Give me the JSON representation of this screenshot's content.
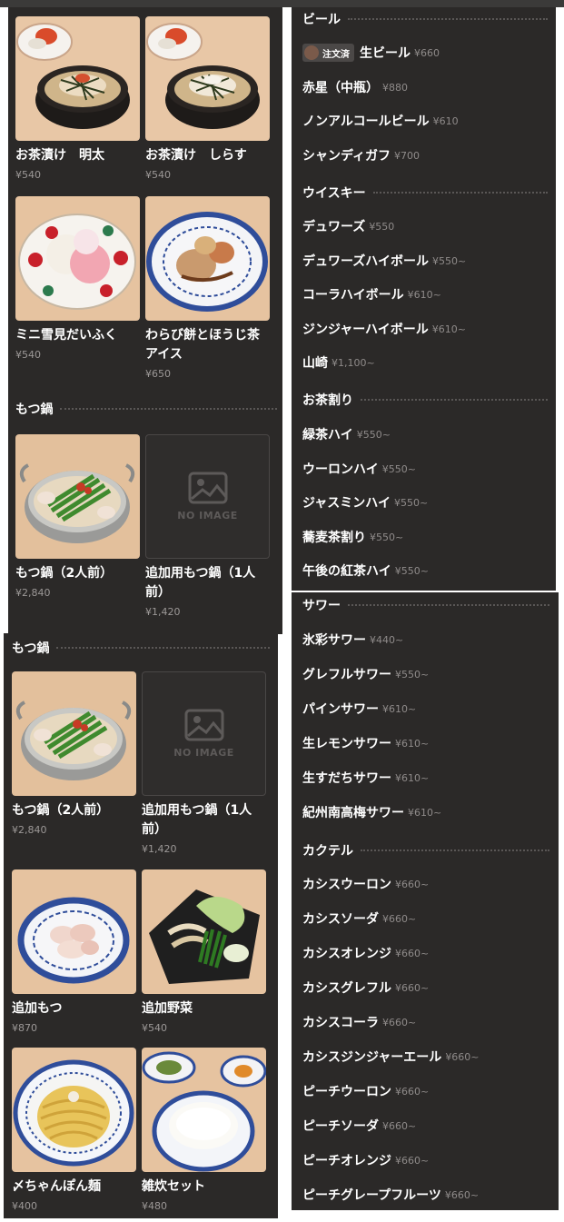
{
  "no_image_label": "NO IMAGE",
  "food_top": {
    "items": [
      {
        "name": "お茶漬け　明太",
        "price": "¥540"
      },
      {
        "name": "お茶漬け　しらす",
        "price": "¥540"
      },
      {
        "name": "ミニ雪見だいふく",
        "price": "¥540"
      },
      {
        "name": "わらび餅とほうじ茶アイス",
        "price": "¥650"
      }
    ],
    "section_title": "もつ鍋",
    "section_items": [
      {
        "name": "もつ鍋（2人前）",
        "price": "¥2,840"
      },
      {
        "name": "追加用もつ鍋（1人前）",
        "price": "¥1,420"
      }
    ]
  },
  "food_bottom": {
    "section_title": "もつ鍋",
    "items": [
      {
        "name": "もつ鍋（2人前）",
        "price": "¥2,840"
      },
      {
        "name": "追加用もつ鍋（1人前）",
        "price": "¥1,420"
      },
      {
        "name": "追加もつ",
        "price": "¥870"
      },
      {
        "name": "追加野菜",
        "price": "¥540"
      },
      {
        "name": "〆ちゃんぽん麺",
        "price": "¥400"
      },
      {
        "name": "雑炊セット",
        "price": "¥480"
      }
    ]
  },
  "drinks_top": {
    "beer_title": "ビール",
    "ordered_badge": "注文済",
    "beer": [
      {
        "name": "生ビール",
        "price": "¥660"
      },
      {
        "name": "赤星（中瓶）",
        "price": "¥880"
      },
      {
        "name": "ノンアルコールビール",
        "price": "¥610"
      },
      {
        "name": "シャンディガフ",
        "price": "¥700"
      }
    ],
    "whisky_title": "ウイスキー",
    "whisky": [
      {
        "name": "デュワーズ",
        "price": "¥550"
      },
      {
        "name": "デュワーズハイボール",
        "price": "¥550~"
      },
      {
        "name": "コーラハイボール",
        "price": "¥610~"
      },
      {
        "name": "ジンジャーハイボール",
        "price": "¥610~"
      },
      {
        "name": "山崎",
        "price": "¥1,100~"
      }
    ],
    "tea_title": "お茶割り",
    "tea": [
      {
        "name": "緑茶ハイ",
        "price": "¥550~"
      },
      {
        "name": "ウーロンハイ",
        "price": "¥550~"
      },
      {
        "name": "ジャスミンハイ",
        "price": "¥550~"
      },
      {
        "name": "蕎麦茶割り",
        "price": "¥550~"
      },
      {
        "name": "午後の紅茶ハイ",
        "price": "¥550~"
      }
    ]
  },
  "drinks_bottom": {
    "sour_title": "サワー",
    "sour": [
      {
        "name": "氷彩サワー",
        "price": "¥440~"
      },
      {
        "name": "グレフルサワー",
        "price": "¥550~"
      },
      {
        "name": "パインサワー",
        "price": "¥610~"
      },
      {
        "name": "生レモンサワー",
        "price": "¥610~"
      },
      {
        "name": "生すだちサワー",
        "price": "¥610~"
      },
      {
        "name": "紀州南高梅サワー",
        "price": "¥610~"
      }
    ],
    "cocktail_title": "カクテル",
    "cocktail": [
      {
        "name": "カシスウーロン",
        "price": "¥660~"
      },
      {
        "name": "カシスソーダ",
        "price": "¥660~"
      },
      {
        "name": "カシスオレンジ",
        "price": "¥660~"
      },
      {
        "name": "カシスグレフル",
        "price": "¥660~"
      },
      {
        "name": "カシスコーラ",
        "price": "¥660~"
      },
      {
        "name": "カシスジンジャーエール",
        "price": "¥660~"
      },
      {
        "name": "ピーチウーロン",
        "price": "¥660~"
      },
      {
        "name": "ピーチソーダ",
        "price": "¥660~"
      },
      {
        "name": "ピーチオレンジ",
        "price": "¥660~"
      },
      {
        "name": "ピーチグレープフルーツ",
        "price": "¥660~"
      }
    ]
  }
}
